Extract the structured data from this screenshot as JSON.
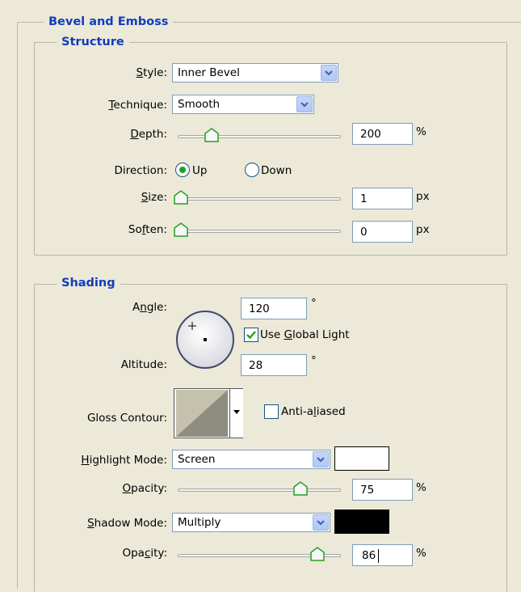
{
  "section_title": "Bevel and Emboss",
  "structure": {
    "title": "Structure",
    "style_label": "Style:",
    "style_value": "Inner Bevel",
    "technique_label": "Technique:",
    "technique_value": "Smooth",
    "depth_label": "Depth:",
    "depth_value": "200",
    "depth_unit": "%",
    "direction_label": "Direction:",
    "direction_up": "Up",
    "direction_down": "Down",
    "direction_selected": "Up",
    "size_label": "Size:",
    "size_value": "1",
    "size_unit": "px",
    "soften_label": "Soften:",
    "soften_value": "0",
    "soften_unit": "px"
  },
  "shading": {
    "title": "Shading",
    "angle_label": "Angle:",
    "angle_value": "120",
    "degree_symbol": "°",
    "use_global_light_label": "Use Global Light",
    "use_global_light_checked": true,
    "altitude_label": "Altitude:",
    "altitude_value": "28",
    "gloss_contour_label": "Gloss Contour:",
    "anti_aliased_label": "Anti-aliased",
    "anti_aliased_checked": false,
    "highlight_mode_label": "Highlight Mode:",
    "highlight_mode_value": "Screen",
    "highlight_color": "#ffffff",
    "highlight_opacity_label": "Opacity:",
    "highlight_opacity_value": "75",
    "shadow_mode_label": "Shadow Mode:",
    "shadow_mode_value": "Multiply",
    "shadow_color": "#000000",
    "shadow_opacity_label": "Opacity:",
    "shadow_opacity_value": "86",
    "percent_unit": "%"
  }
}
